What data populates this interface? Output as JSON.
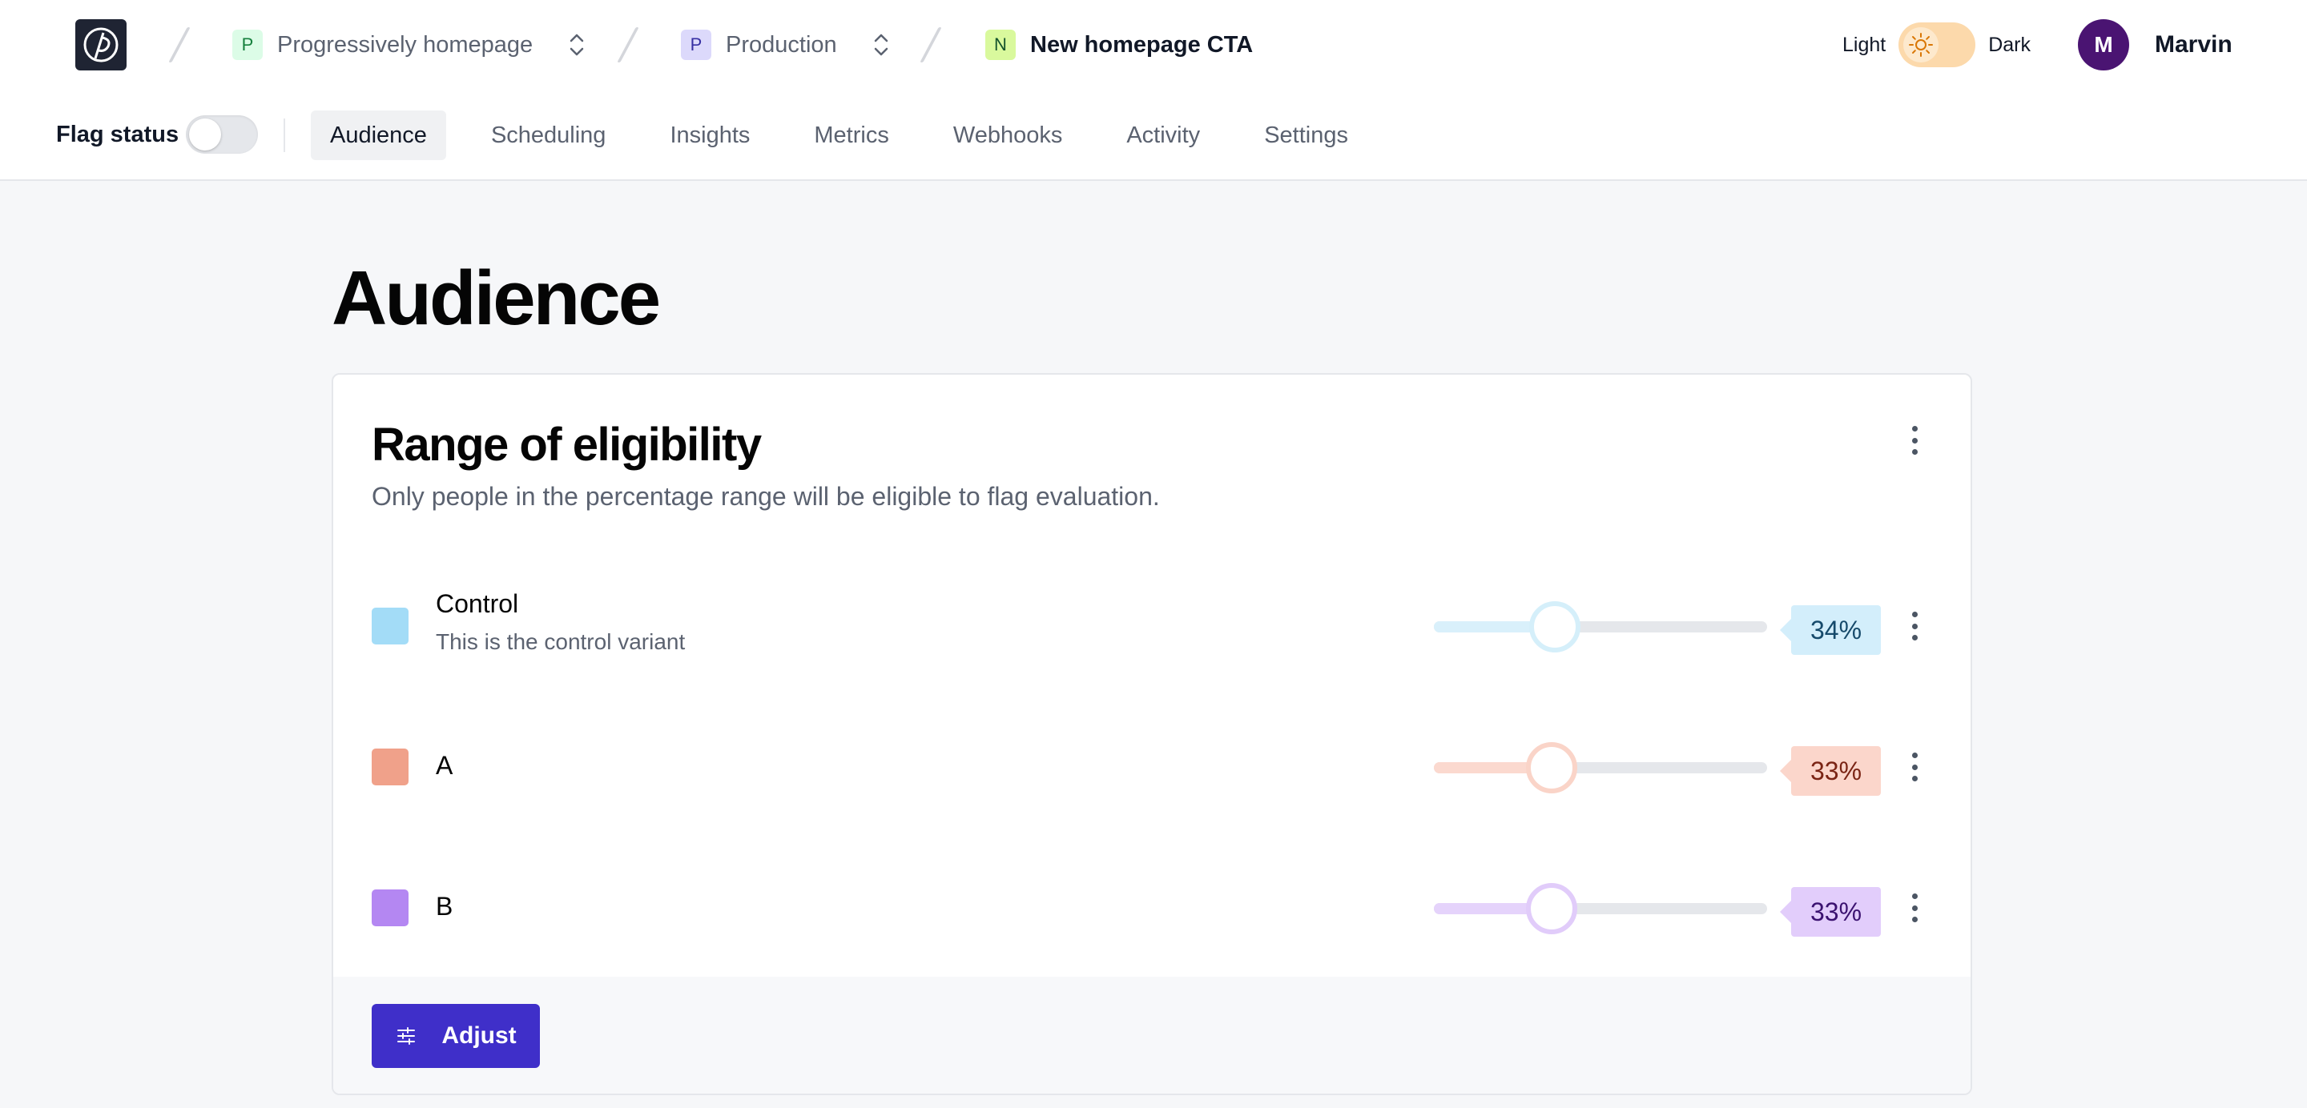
{
  "header": {
    "breadcrumbs": [
      {
        "badge": "P",
        "label": "Progressively homepage",
        "badge_bg": "#dcfce7",
        "badge_fg": "#15803d"
      },
      {
        "badge": "P",
        "label": "Production",
        "badge_bg": "#dcd9fb",
        "badge_fg": "#3730a3"
      },
      {
        "badge": "N",
        "label": "New homepage CTA",
        "badge_bg": "#d9f99d",
        "badge_fg": "#14532d"
      }
    ],
    "theme": {
      "light_label": "Light",
      "dark_label": "Dark",
      "mode": "light"
    },
    "user": {
      "initial": "M",
      "name": "Marvin"
    }
  },
  "subnav": {
    "flag_status_label": "Flag status",
    "flag_status_on": false,
    "tabs": [
      "Audience",
      "Scheduling",
      "Insights",
      "Metrics",
      "Webhooks",
      "Activity",
      "Settings"
    ],
    "active_tab": "Audience"
  },
  "page": {
    "title": "Audience"
  },
  "eligibility": {
    "title": "Range of eligibility",
    "description": "Only people in the percentage range will be eligible to flag evaluation.",
    "variants": [
      {
        "name": "Control",
        "description": "This is the control variant",
        "percent_label": "34%",
        "percent": 34,
        "color": "#a3dcf7",
        "thumb_color": "#d5effa",
        "fill_color": "#d9f0fb",
        "pct_bg": "#d3eefb",
        "pct_fg": "#164a6b"
      },
      {
        "name": "A",
        "description": "",
        "percent_label": "33%",
        "percent": 33,
        "color": "#f0a18a",
        "thumb_color": "#fad4c8",
        "fill_color": "#fbd9cf",
        "pct_bg": "#fbd6cb",
        "pct_fg": "#7a2414"
      },
      {
        "name": "B",
        "description": "",
        "percent_label": "33%",
        "percent": 33,
        "color": "#b487f2",
        "thumb_color": "#e1ccfa",
        "fill_color": "#e5d3fb",
        "pct_bg": "#e2cdfb",
        "pct_fg": "#3b1270"
      }
    ],
    "adjust_label": "Adjust"
  }
}
